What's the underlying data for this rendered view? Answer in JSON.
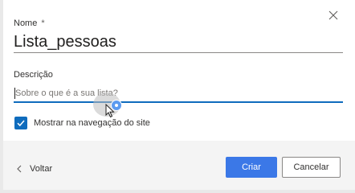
{
  "dialog": {
    "close_icon": "close-icon",
    "name_field": {
      "label": "Nome",
      "required_mark": "*",
      "value": "Lista_pessoas"
    },
    "description_field": {
      "label": "Descrição",
      "value": "",
      "placeholder": "Sobre o que é a sua lista?"
    },
    "show_in_navigation": {
      "label": "Mostrar na navegação do site",
      "checked": true
    },
    "footer": {
      "back_label": "Voltar",
      "back_icon": "chevron-left-icon",
      "create_label": "Criar",
      "cancel_label": "Cancelar"
    }
  },
  "colors": {
    "accent": "#0f6cbd",
    "primary_button": "#3b78e7",
    "footer_background": "#f4f4f4"
  }
}
